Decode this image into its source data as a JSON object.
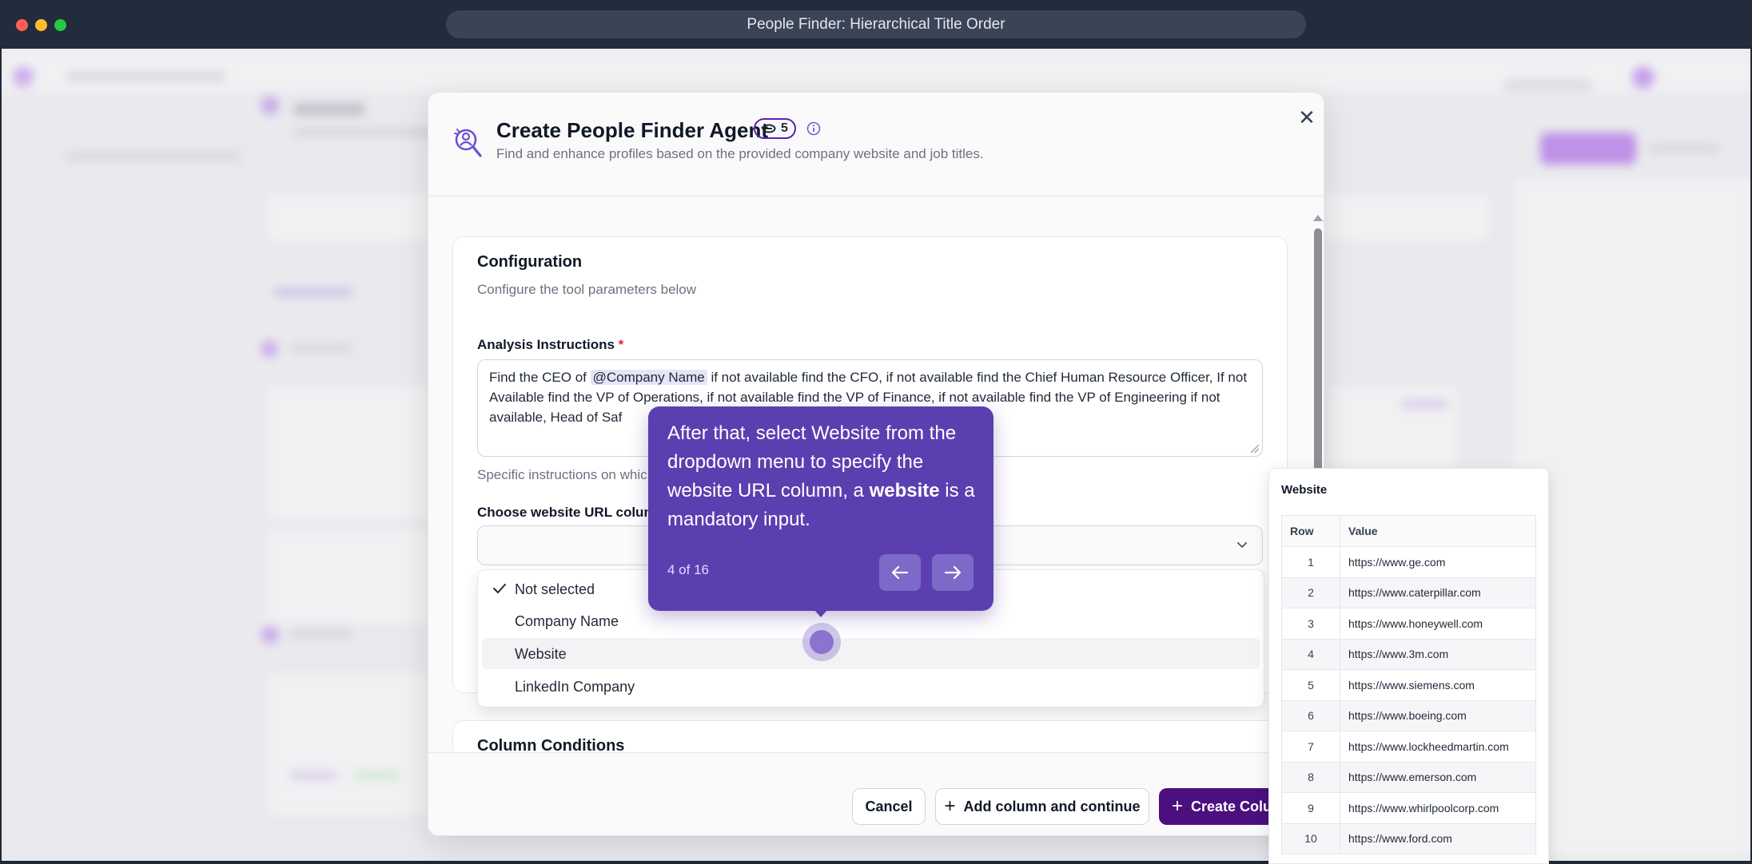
{
  "window": {
    "title": "People Finder: Hierarchical Title Order"
  },
  "modal": {
    "title": "Create People Finder Agent",
    "credits": "5",
    "subtitle": "Find and enhance profiles based on the provided company website and job titles.",
    "configuration": {
      "title": "Configuration",
      "description": "Configure the tool parameters below",
      "analysis_label": "Analysis Instructions",
      "required_mark": "*",
      "instructions_before": "Find the CEO of ",
      "instructions_mention": "@Company Name",
      "instructions_after": "  if not available find the CFO, if not available find the Chief Human Resource Officer, If not Available find the VP of Operations, if not available find the VP of Finance, if not available find the VP of Engineering if not available, Head of Saf",
      "helper_text": "Specific instructions on whic",
      "website_label": "Choose website URL colum",
      "dropdown_options": [
        {
          "label": "Not selected",
          "checked": true,
          "highlighted": false
        },
        {
          "label": "Company Name",
          "checked": false,
          "highlighted": false
        },
        {
          "label": "Website",
          "checked": false,
          "highlighted": true
        },
        {
          "label": "LinkedIn Company",
          "checked": false,
          "highlighted": false
        }
      ]
    },
    "column_conditions": {
      "title": "Column Conditions"
    },
    "footer": {
      "cancel_label": "Cancel",
      "add_label": "Add column and continue",
      "create_label": "Create Colu"
    }
  },
  "tooltip": {
    "text_before": "After that, select Website from the dropdown menu to specify the website URL column, a ",
    "text_bold": "website",
    "text_after": " is a mandatory input.",
    "step": "4 of 16"
  },
  "preview": {
    "title": "Website",
    "columns": [
      "Row",
      "Value"
    ],
    "rows": [
      {
        "row": "1",
        "value": "https://www.ge.com"
      },
      {
        "row": "2",
        "value": "https://www.caterpillar.com"
      },
      {
        "row": "3",
        "value": "https://www.honeywell.com"
      },
      {
        "row": "4",
        "value": "https://www.3m.com"
      },
      {
        "row": "5",
        "value": "https://www.siemens.com"
      },
      {
        "row": "6",
        "value": "https://www.boeing.com"
      },
      {
        "row": "7",
        "value": "https://www.lockheedmartin.com"
      },
      {
        "row": "8",
        "value": "https://www.emerson.com"
      },
      {
        "row": "9",
        "value": "https://www.whirlpoolcorp.com"
      },
      {
        "row": "10",
        "value": "https://www.ford.com"
      }
    ]
  },
  "colors": {
    "accent": "#5b3fb0",
    "primary_button": "#4b0f7e",
    "titlebar": "#222c3d"
  }
}
